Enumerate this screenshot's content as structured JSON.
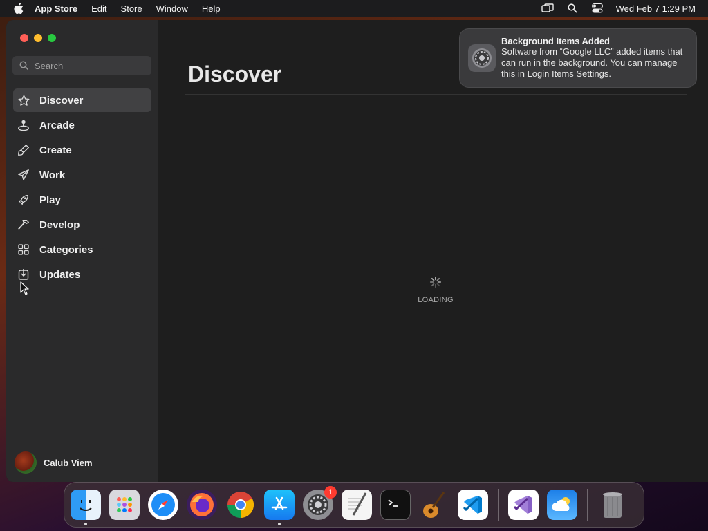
{
  "menubar": {
    "apple_icon": "apple-icon",
    "app_name": "App Store",
    "items": [
      "Edit",
      "Store",
      "Window",
      "Help"
    ],
    "datetime": "Wed Feb 7  1:29 PM"
  },
  "sidebar": {
    "search_placeholder": "Search",
    "items": [
      {
        "label": "Discover",
        "icon": "star-icon",
        "active": true
      },
      {
        "label": "Arcade",
        "icon": "joystick-icon"
      },
      {
        "label": "Create",
        "icon": "brush-icon"
      },
      {
        "label": "Work",
        "icon": "paper-plane-icon"
      },
      {
        "label": "Play",
        "icon": "rocket-icon"
      },
      {
        "label": "Develop",
        "icon": "hammer-icon"
      },
      {
        "label": "Categories",
        "icon": "grid-icon"
      },
      {
        "label": "Updates",
        "icon": "download-icon"
      }
    ],
    "user_name": "Calub Viem"
  },
  "main": {
    "title": "Discover",
    "loading_text": "LOADING"
  },
  "notification": {
    "title": "Background Items Added",
    "body": "Software from “Google LLC” added items that can run in the background. You can manage this in Login Items Settings."
  },
  "dock": {
    "apps": [
      "Finder",
      "Launchpad",
      "Safari",
      "Firefox",
      "Chrome",
      "App Store",
      "System Settings",
      "TextEdit",
      "Terminal",
      "GarageBand",
      "Visual Studio Code",
      "Visual Studio",
      "Weather",
      "Trash"
    ],
    "system_settings_badge": "1"
  },
  "colors": {
    "active_item_bg": "#414143",
    "window_bg": "#1e1e1e",
    "sidebar_bg": "#2a2a2b",
    "badge": "#ff3b30"
  }
}
